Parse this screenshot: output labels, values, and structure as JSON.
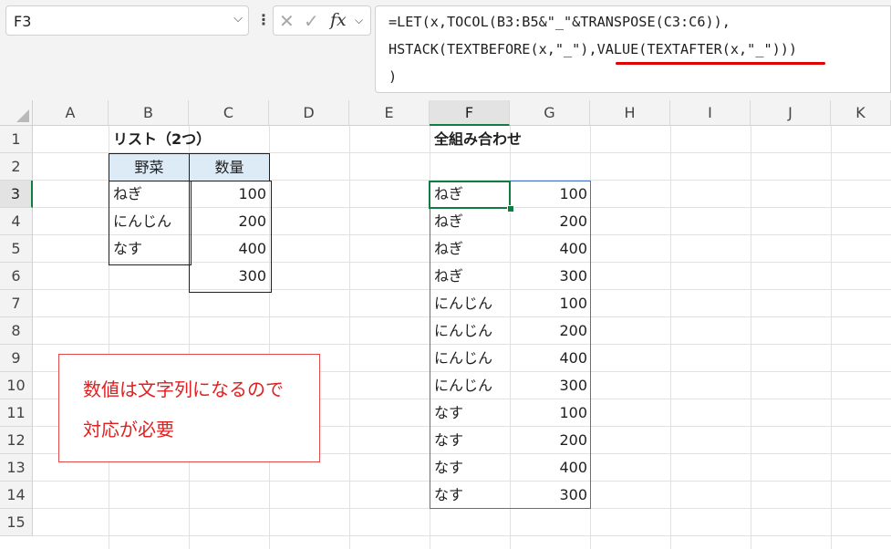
{
  "name_box": {
    "value": "F3"
  },
  "formula_bar": {
    "fx_label": "fx",
    "lines": [
      "=LET(x,TOCOL(B3:B5&\"_\"&TRANSPOSE(C3:C6)),",
      "HSTACK(TEXTBEFORE(x,\"_\"),VALUE(TEXTAFTER(x,\"_\")))",
      ")"
    ],
    "highlight_color": "#e00000"
  },
  "columns": [
    "A",
    "B",
    "C",
    "D",
    "E",
    "F",
    "G",
    "H",
    "I",
    "J",
    "K"
  ],
  "rows": [
    "1",
    "2",
    "3",
    "4",
    "5",
    "6",
    "7",
    "8",
    "9",
    "10",
    "11",
    "12",
    "13",
    "14",
    "15"
  ],
  "selected": {
    "column": "F",
    "row": "3"
  },
  "list_table": {
    "title": "リスト（2つ）",
    "header_vegetable": "野菜",
    "header_quantity": "数量",
    "vegetables": [
      "ねぎ",
      "にんじん",
      "なす"
    ],
    "quantities": [
      "100",
      "200",
      "400",
      "300"
    ],
    "header_fill": "#ddebf7"
  },
  "combinations": {
    "title": "全組み合わせ",
    "items": [
      [
        "ねぎ",
        "100"
      ],
      [
        "ねぎ",
        "200"
      ],
      [
        "ねぎ",
        "400"
      ],
      [
        "ねぎ",
        "300"
      ],
      [
        "にんじん",
        "100"
      ],
      [
        "にんじん",
        "200"
      ],
      [
        "にんじん",
        "400"
      ],
      [
        "にんじん",
        "300"
      ],
      [
        "なす",
        "100"
      ],
      [
        "なす",
        "200"
      ],
      [
        "なす",
        "400"
      ],
      [
        "なす",
        "300"
      ]
    ]
  },
  "note": {
    "line1": "数値は文字列になるので",
    "line2": "対応が必要",
    "color": "#e02020"
  }
}
